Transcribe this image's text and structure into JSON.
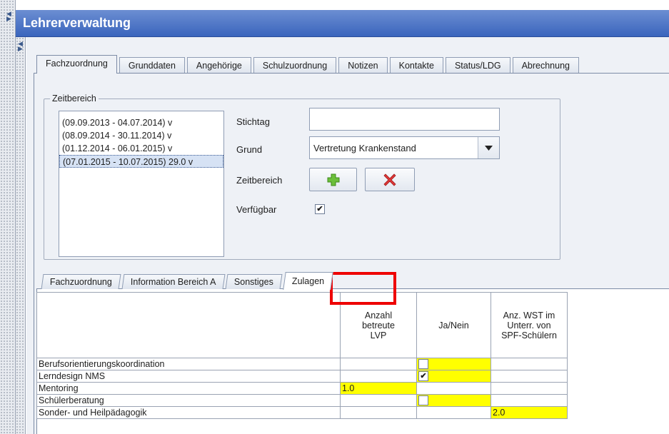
{
  "window": {
    "title": "Lehrerverwaltung"
  },
  "top_tabs": [
    {
      "label": "Fachzuordnung",
      "active": true
    },
    {
      "label": "Grunddaten",
      "active": false
    },
    {
      "label": "Angehörige",
      "active": false
    },
    {
      "label": "Schulzuordnung",
      "active": false
    },
    {
      "label": "Notizen",
      "active": false
    },
    {
      "label": "Kontakte",
      "active": false
    },
    {
      "label": "Status/LDG",
      "active": false
    },
    {
      "label": "Abrechnung",
      "active": false
    }
  ],
  "zeitbereich": {
    "group_label": "Zeitbereich",
    "items": [
      {
        "label": "(09.09.2013 - 04.07.2014) v",
        "selected": false
      },
      {
        "label": "(08.09.2014 - 30.11.2014) v",
        "selected": false
      },
      {
        "label": "(01.12.2014 - 06.01.2015) v",
        "selected": false
      },
      {
        "label": "(07.01.2015 - 10.07.2015) 29.0 v",
        "selected": true
      }
    ],
    "stichtag_label": "Stichtag",
    "stichtag_value": "",
    "grund_label": "Grund",
    "grund_value": "Vertretung Krankenstand",
    "zeitbereich_label": "Zeitbereich",
    "add_icon": "plus-icon",
    "remove_icon": "x-icon",
    "verfuegbar_label": "Verfügbar",
    "verfuegbar_checked": true
  },
  "sub_tabs": [
    {
      "label": "Fachzuordnung",
      "active": false
    },
    {
      "label": "Information Bereich A",
      "active": false
    },
    {
      "label": "Sonstiges",
      "active": false
    },
    {
      "label": "Zulagen",
      "active": true
    }
  ],
  "zulagen_table": {
    "headers": [
      "",
      "Anzahl betreute LVP",
      "Ja/Nein",
      "Anz. WST im Unterr. von SPF-Schülern"
    ],
    "rows": [
      {
        "label": "Berufsorientierungskoordination",
        "lvp": "",
        "janein": "unchecked",
        "wst": ""
      },
      {
        "label": "Lerndesign NMS",
        "lvp": "",
        "janein": "checked",
        "wst": ""
      },
      {
        "label": "Mentoring",
        "lvp": "1.0",
        "janein": "",
        "wst": ""
      },
      {
        "label": "Schülerberatung",
        "lvp": "",
        "janein": "unchecked",
        "wst": ""
      },
      {
        "label": "Sonder- und Heilpädagogik",
        "lvp": "",
        "janein": "",
        "wst": "2.0"
      }
    ]
  },
  "colors": {
    "title_bar": "#3a65bd",
    "highlight": "#ffff00",
    "annotation": "#ee0000"
  }
}
